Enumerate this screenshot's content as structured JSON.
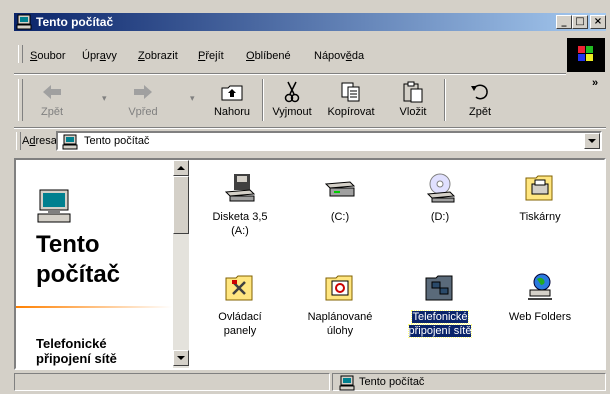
{
  "window": {
    "title": "Tento počítač"
  },
  "menu": {
    "items": [
      {
        "pre": "",
        "acc": "S",
        "post": "oubor"
      },
      {
        "pre": "Úpr",
        "acc": "a",
        "post": "vy"
      },
      {
        "pre": "",
        "acc": "Z",
        "post": "obrazit"
      },
      {
        "pre": "",
        "acc": "P",
        "post": "řejít"
      },
      {
        "pre": "",
        "acc": "O",
        "post": "blíbené"
      },
      {
        "pre": "Nápov",
        "acc": "ě",
        "post": "da"
      }
    ]
  },
  "toolbar": {
    "back": "Zpět",
    "forward": "Vpřed",
    "up": "Nahoru",
    "cut": "Vyjmout",
    "copy": "Kopírovat",
    "paste": "Vložit",
    "undo": "Zpět",
    "more": "»"
  },
  "address": {
    "label_pre": "A",
    "label_acc": "d",
    "label_post": "resa",
    "value": "Tento počítač"
  },
  "left_panel": {
    "title_line1": "Tento",
    "title_line2": "počítač",
    "desc_line1": "Telefonické",
    "desc_line2": "připojení sítě"
  },
  "items": [
    {
      "label1": "Disketa 3,5",
      "label2": "(A:)",
      "icon": "floppy-drive-icon"
    },
    {
      "label1": "(C:)",
      "label2": "",
      "icon": "hard-drive-icon"
    },
    {
      "label1": "(D:)",
      "label2": "",
      "icon": "cd-drive-icon"
    },
    {
      "label1": "Tiskárny",
      "label2": "",
      "icon": "printers-folder-icon"
    },
    {
      "label1": "Ovládací",
      "label2": "panely",
      "icon": "control-panel-folder-icon"
    },
    {
      "label1": "Naplánované",
      "label2": "úlohy",
      "icon": "scheduled-tasks-folder-icon"
    },
    {
      "label1": "Telefonické",
      "label2": "připojení sítě",
      "icon": "dialup-networking-folder-icon"
    },
    {
      "label1": "Web Folders",
      "label2": "",
      "icon": "web-folders-icon"
    }
  ],
  "status": {
    "location": "Tento počítač"
  },
  "colors": {
    "title_active": "#0a246a",
    "title_gradient_end": "#a6caf0",
    "face": "#d4d0c8",
    "selection": "#0a246a"
  }
}
